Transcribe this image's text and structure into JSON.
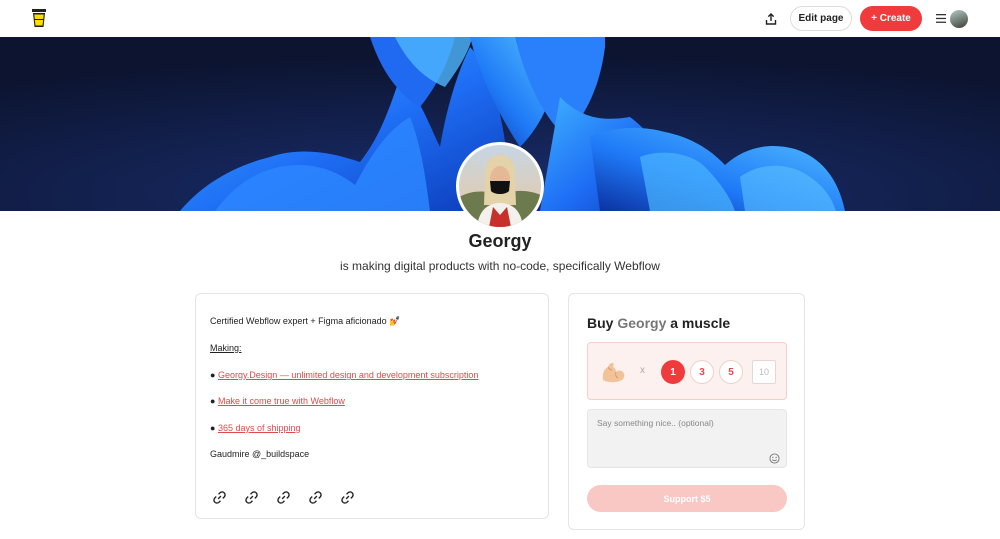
{
  "header": {
    "logo": "coffee-cup-logo",
    "share_icon": "share-icon",
    "edit_label": "Edit page",
    "create_label": "+ Create",
    "menu_icon": "hamburger-menu-icon"
  },
  "colors": {
    "accent": "#ef3b3b",
    "link": "#e04a4a",
    "banner_bg": "#111a3a",
    "banner_shape": "#1e6ef5"
  },
  "profile": {
    "name": "Georgy",
    "tagline": "is making digital products with no-code, specifically Webflow"
  },
  "about": {
    "intro": "Certified Webflow expert + Figma aficionado 💅",
    "making_heading": "Making:",
    "bullet": "●",
    "links": [
      "Georgy.Design — unlimited design and development subscription",
      "Make it come true with Webflow",
      "365 days of shipping"
    ],
    "footer": "Gaudmire @_buildspace",
    "social_icons": [
      "link-icon",
      "link-icon",
      "link-icon",
      "link-icon",
      "link-icon"
    ]
  },
  "support": {
    "title_prefix": "Buy",
    "title_name": "Georgy",
    "title_suffix": "a muscle",
    "unit_icon": "flexed-biceps-icon",
    "times": "x",
    "options": [
      "1",
      "3",
      "5"
    ],
    "selected": "1",
    "custom_placeholder": "10",
    "message_placeholder": "Say something nice.. (optional)",
    "emoji_icon": "smiley-icon",
    "button_label": "Support $5"
  }
}
